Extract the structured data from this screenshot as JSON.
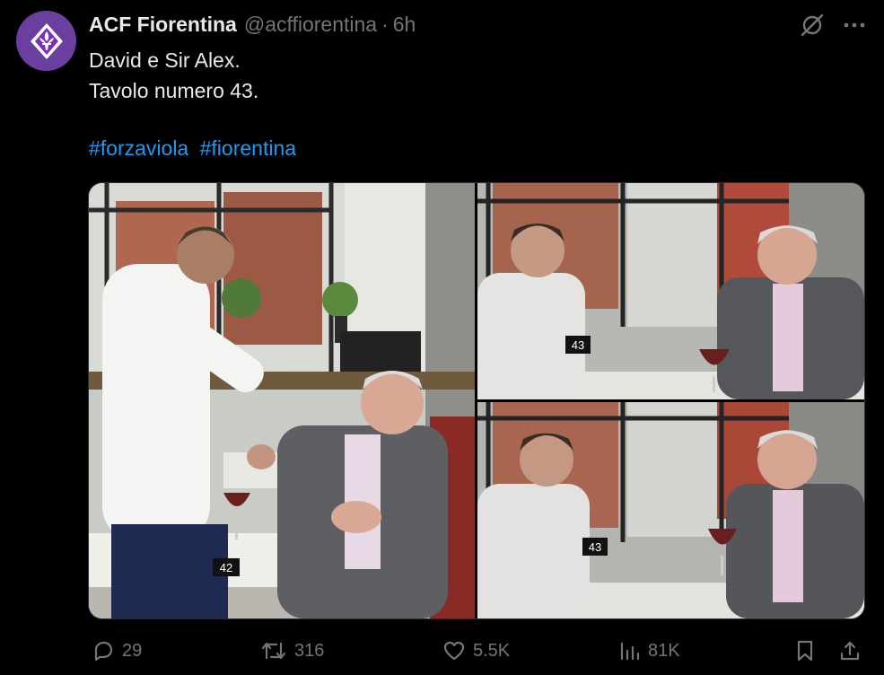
{
  "tweet": {
    "author_name": "ACF Fiorentina",
    "handle": "@acffiorentina",
    "separator": "·",
    "time": "6h",
    "lines": [
      "David e Sir Alex.",
      "Tavolo numero 43."
    ],
    "hashtags": [
      "#forzaviola",
      "#fiorentina"
    ]
  },
  "actions": {
    "replies": "29",
    "reposts": "316",
    "likes": "5.5K",
    "views": "81K"
  },
  "photos": {
    "table_numbers": [
      "42",
      "43",
      "43"
    ]
  },
  "icons": {
    "avatar": "fiorentina-lily-logo",
    "grok": "grok-icon",
    "more": "more-icon",
    "reply": "reply-icon",
    "repost": "repost-icon",
    "like": "like-icon",
    "views": "views-icon",
    "bookmark": "bookmark-icon",
    "share": "share-icon"
  },
  "colors": {
    "background": "#000000",
    "text": "#e7e9ea",
    "muted": "#71767b",
    "link": "#1d9bf0",
    "avatar": "#6b3fa0"
  }
}
